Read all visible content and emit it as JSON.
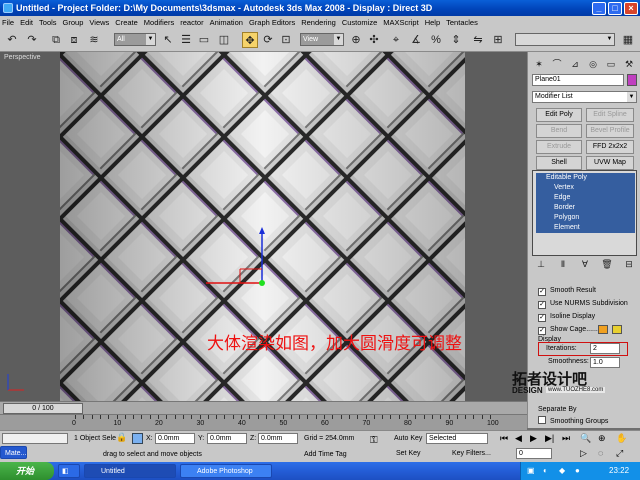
{
  "window": {
    "title": "Untitled     - Project Folder: D:\\My Documents\\3dsmax     - Autodesk 3ds Max 2008     - Display : Direct 3D",
    "min": "_",
    "max": "□",
    "close": "×"
  },
  "menu": [
    "File",
    "Edit",
    "Tools",
    "Group",
    "Views",
    "Create",
    "Modifiers",
    "reactor",
    "Animation",
    "Graph Editors",
    "Rendering",
    "Customize",
    "MAXScript",
    "Help",
    "Tentacles"
  ],
  "toolbar": {
    "selection_filter": "All",
    "ref_coord": "View",
    "named_selection": ""
  },
  "viewport": {
    "label": "Perspective",
    "note": "大体渲染如图，加大圆滑度可调整"
  },
  "command_panel": {
    "object_name": "Plane01",
    "object_color": "#c040c0",
    "modifier_list": "Modifier List",
    "buttons": [
      "Edit Poly",
      "Edit Spline",
      "Bend",
      "Bevel Profile",
      "Extrude",
      "FFD 2x2x2",
      "Shell",
      "UVW Map"
    ],
    "disabled_buttons": [
      "Edit Spline",
      "Bend",
      "Bevel Profile",
      "Extrude"
    ],
    "stack": {
      "root": "Editable Poly",
      "subs": [
        "Vertex",
        "Edge",
        "Border",
        "Polygon",
        "Element"
      ]
    },
    "checks": [
      {
        "label": "Smooth Result",
        "checked": true
      },
      {
        "label": "Use NURMS Subdivision",
        "checked": true
      },
      {
        "label": "Isoline Display",
        "checked": true
      },
      {
        "label": "Show Cage.......",
        "checked": true
      }
    ],
    "cage_colors": [
      "#f0a020",
      "#e8d030"
    ],
    "display_label": "Display",
    "iterations_label": "Iterations:",
    "iterations_value": "2",
    "smoothness_label": "Smoothness:",
    "smoothness_value": "1.0",
    "separate_by": "Separate By",
    "smoothing_groups": "Smoothing Groups"
  },
  "timeline": {
    "slider": "0 / 100",
    "ticks": [
      "0",
      "10",
      "20",
      "30",
      "40",
      "50",
      "60",
      "70",
      "80",
      "90",
      "100"
    ]
  },
  "status": {
    "selected": "1 Object Sele",
    "x_label": "X:",
    "x": "0.0mm",
    "y_label": "Y:",
    "y": "0.0mm",
    "z_label": "Z:",
    "z": "0.0mm",
    "grid": "Grid = 254.0mm",
    "auto_key": "Auto Key",
    "selected_combo": "Selected",
    "set_key": "Set Key",
    "key_filters": "Key Filters...",
    "frame": "0",
    "prompt": "drag to select and move objects",
    "add_time_tag": "Add Time Tag",
    "mini_listener": "Mate..."
  },
  "taskbar": {
    "start": "开始",
    "tasks": [
      "Untitled",
      "Adobe Photoshop"
    ],
    "clock": "23:22"
  },
  "watermark": {
    "main": "拓者设计吧",
    "sub": "DESIGN",
    "url": "www.TUOZHE8.com"
  }
}
